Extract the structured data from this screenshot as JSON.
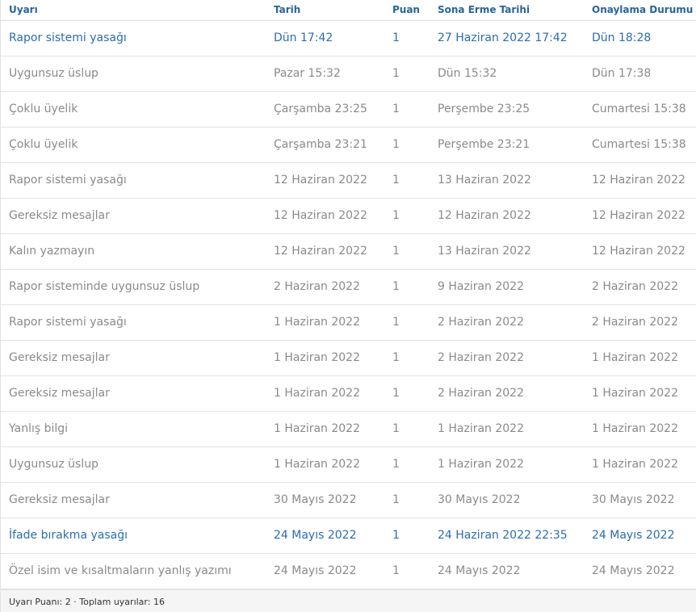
{
  "columns": [
    "Uyarı",
    "Tarih",
    "Puan",
    "Sona Erme Tarihi",
    "Onaylama Durumu"
  ],
  "rows": [
    {
      "warning": "Rapor sistemi yasağı",
      "date": "Dün 17:42",
      "points": "1",
      "expires": "27 Haziran 2022 17:42",
      "approval": "Dün 18:28",
      "active": true
    },
    {
      "warning": "Uygunsuz üslup",
      "date": "Pazar 15:32",
      "points": "1",
      "expires": "Dün 15:32",
      "approval": "Dün 17:38",
      "active": false
    },
    {
      "warning": "Çoklu üyelik",
      "date": "Çarşamba 23:25",
      "points": "1",
      "expires": "Perşembe 23:25",
      "approval": "Cumartesi 15:38",
      "active": false
    },
    {
      "warning": "Çoklu üyelik",
      "date": "Çarşamba 23:21",
      "points": "1",
      "expires": "Perşembe 23:21",
      "approval": "Cumartesi 15:38",
      "active": false
    },
    {
      "warning": "Rapor sistemi yasağı",
      "date": "12 Haziran 2022",
      "points": "1",
      "expires": "13 Haziran 2022",
      "approval": "12 Haziran 2022",
      "active": false
    },
    {
      "warning": "Gereksiz mesajlar",
      "date": "12 Haziran 2022",
      "points": "1",
      "expires": "12 Haziran 2022",
      "approval": "12 Haziran 2022",
      "active": false
    },
    {
      "warning": "Kalın yazmayın",
      "date": "12 Haziran 2022",
      "points": "1",
      "expires": "13 Haziran 2022",
      "approval": "12 Haziran 2022",
      "active": false
    },
    {
      "warning": "Rapor sisteminde uygunsuz üslup",
      "date": "2 Haziran 2022",
      "points": "1",
      "expires": "9 Haziran 2022",
      "approval": "2 Haziran 2022",
      "active": false
    },
    {
      "warning": "Rapor sistemi yasağı",
      "date": "1 Haziran 2022",
      "points": "1",
      "expires": "2 Haziran 2022",
      "approval": "2 Haziran 2022",
      "active": false
    },
    {
      "warning": "Gereksiz mesajlar",
      "date": "1 Haziran 2022",
      "points": "1",
      "expires": "2 Haziran 2022",
      "approval": "1 Haziran 2022",
      "active": false
    },
    {
      "warning": "Gereksiz mesajlar",
      "date": "1 Haziran 2022",
      "points": "1",
      "expires": "2 Haziran 2022",
      "approval": "1 Haziran 2022",
      "active": false
    },
    {
      "warning": "Yanlış bilgi",
      "date": "1 Haziran 2022",
      "points": "1",
      "expires": "1 Haziran 2022",
      "approval": "1 Haziran 2022",
      "active": false
    },
    {
      "warning": "Uygunsuz üslup",
      "date": "1 Haziran 2022",
      "points": "1",
      "expires": "1 Haziran 2022",
      "approval": "1 Haziran 2022",
      "active": false
    },
    {
      "warning": "Gereksiz mesajlar",
      "date": "30 Mayıs 2022",
      "points": "1",
      "expires": "30 Mayıs 2022",
      "approval": "30 Mayıs 2022",
      "active": false
    },
    {
      "warning": "İfade bırakma yasağı",
      "date": "24 Mayıs 2022",
      "points": "1",
      "expires": "24 Haziran 2022 22:35",
      "approval": "24 Mayıs 2022",
      "active": true
    },
    {
      "warning": "Özel isim ve kısaltmaların yanlış yazımı",
      "date": "24 Mayıs 2022",
      "points": "1",
      "expires": "24 Mayıs 2022",
      "approval": "24 Mayıs 2022",
      "active": false
    }
  ],
  "footer": "Uyarı Puanı: 2 · Toplam uyarılar: 16",
  "colors": {
    "header_text": "#2a6496",
    "active_text": "#2a6db0",
    "muted_text": "#8a8a8a"
  }
}
